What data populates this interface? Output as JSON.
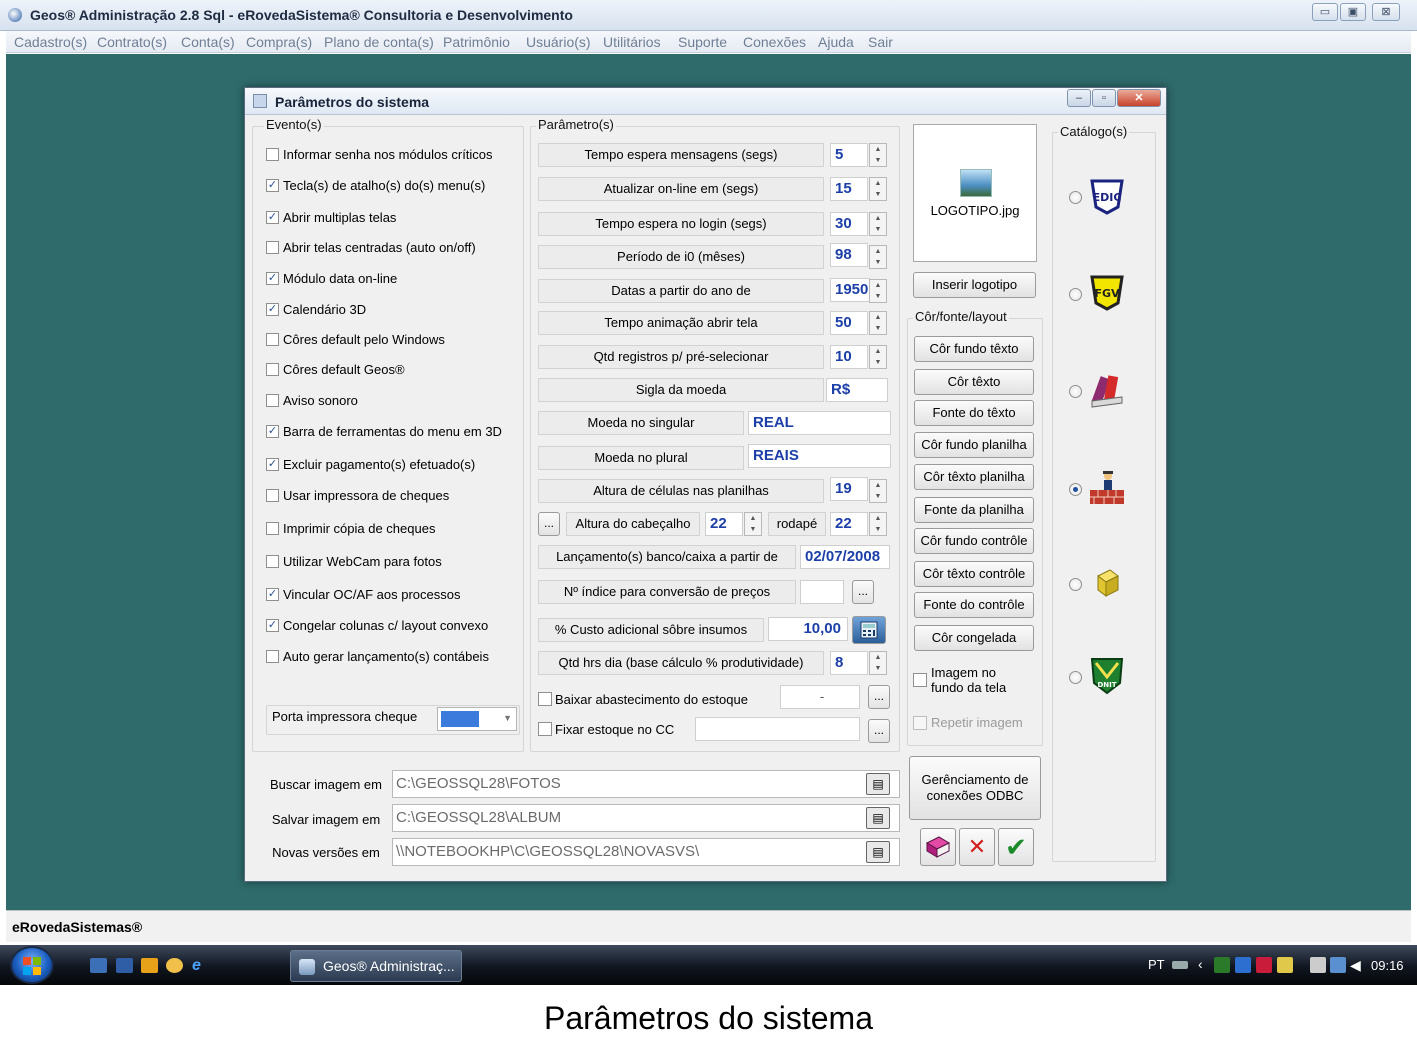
{
  "window": {
    "title": "Geos® Administração 2.8 Sql - eRovedaSistema® Consultoria e Desenvolvimento",
    "min": "▭",
    "max": "▣",
    "close": "⊠"
  },
  "menu": [
    "Cadastro(s)",
    "Contrato(s)",
    "Conta(s)",
    "Compra(s)",
    "Plano de conta(s)",
    "Patrimônio",
    "Usuário(s)",
    "Utilitários",
    "Suporte",
    "Conexões",
    "Ajuda",
    "Sair"
  ],
  "dialog": {
    "title": "Parâmetros do sistema",
    "min": "–",
    "max": "▫",
    "close": "✕"
  },
  "eventos": {
    "label": "Evento(s)",
    "items": [
      {
        "label": "Informar senha nos módulos críticos",
        "checked": false
      },
      {
        "label": "Tecla(s) de atalho(s) do(s) menu(s)",
        "checked": true
      },
      {
        "label": "Abrir multiplas telas",
        "checked": true
      },
      {
        "label": "Abrir telas centradas (auto on/off)",
        "checked": false
      },
      {
        "label": "Módulo data on-line",
        "checked": true
      },
      {
        "label": "Calendário 3D",
        "checked": true
      },
      {
        "label": "Côres default pelo Windows",
        "checked": false
      },
      {
        "label": "Côres default  Geos®",
        "checked": false
      },
      {
        "label": "Aviso sonoro",
        "checked": false
      },
      {
        "label": "Barra de ferramentas do menu em 3D",
        "checked": true
      },
      {
        "label": "Excluir pagamento(s) efetuado(s)",
        "checked": true
      },
      {
        "label": "Usar impressora de cheques",
        "checked": false
      },
      {
        "label": "Imprimir cópia de cheques",
        "checked": false
      },
      {
        "label": "Utilizar WebCam para fotos",
        "checked": false
      },
      {
        "label": "Vincular OC/AF aos processos",
        "checked": true
      },
      {
        "label": "Congelar colunas c/ layout convexo",
        "checked": true
      },
      {
        "label": "Auto gerar lançamento(s) contábeis",
        "checked": false
      }
    ],
    "porta_label": "Porta impressora cheque",
    "porta_value": ""
  },
  "parametros": {
    "label": "Parâmetro(s)",
    "tempo_mensagens": {
      "label": "Tempo espera mensagens (segs)",
      "value": "5"
    },
    "atualizar_online": {
      "label": "Atualizar  on-line em (segs)",
      "value": "15"
    },
    "tempo_login": {
      "label": "Tempo espera no login (segs)",
      "value": "30"
    },
    "periodo_i0": {
      "label": "Período de i0 (mêses)",
      "value": "98"
    },
    "datas_ano": {
      "label": "Datas a partir do ano de",
      "value": "1950"
    },
    "tempo_animacao": {
      "label": "Tempo animação abrir tela",
      "value": "50"
    },
    "qtd_registros": {
      "label": "Qtd registros p/ pré-selecionar",
      "value": "10"
    },
    "sigla_moeda": {
      "label": "Sigla da moeda",
      "value": "R$"
    },
    "moeda_singular": {
      "label": "Moeda no singular",
      "value": "REAL"
    },
    "moeda_plural": {
      "label": "Moeda no plural",
      "value": "REAIS"
    },
    "altura_celulas": {
      "label": "Altura de células nas planilhas",
      "value": "19"
    },
    "altura_cabecalho": {
      "label": "Altura do cabeçalho",
      "value": "22"
    },
    "rodape": {
      "label": "rodapé",
      "value": "22"
    },
    "lancamentos": {
      "label": "Lançamento(s) banco/caixa a partir de",
      "value": "02/07/2008"
    },
    "indice_precos": {
      "label": "Nº índice para conversão de preços",
      "value": ""
    },
    "custo_adicional": {
      "label": "% Custo adicional sôbre insumos",
      "value": "10,00"
    },
    "qtd_hrs": {
      "label": "Qtd hrs dia (base cálculo % produtividade)",
      "value": "8"
    },
    "baixar_estoque": {
      "label": "Baixar abastecimento do estoque",
      "value": "-",
      "checked": false
    },
    "fixar_estoque": {
      "label": "Fixar estoque no CC",
      "value": "",
      "checked": false
    },
    "dots": "..."
  },
  "logo": {
    "filename": "LOGOTIPO.jpg",
    "insert_label": "Inserir logotipo"
  },
  "cor": {
    "label": "Côr/fonte/layout",
    "buttons": [
      "Côr fundo têxto",
      "Côr têxto",
      "Fonte do têxto",
      "Côr fundo planilha",
      "Côr têxto planilha",
      "Fonte da planilha",
      "Côr fundo contrôle",
      "Côr têxto contrôle",
      "Fonte do contrôle",
      "Côr congelada"
    ],
    "imagem_fundo": "Imagem no fundo da tela",
    "repetir": "Repetir imagem"
  },
  "catalogo": {
    "label": "Catálogo(s)",
    "items": [
      "logo-ENDIC",
      "logo-FGV",
      "logo-books",
      "logo-worker-bricks",
      "logo-box",
      "logo-DNIT"
    ],
    "selected": 3
  },
  "paths": [
    {
      "label": "Buscar imagem em",
      "value": "C:\\GEOSSQL28\\FOTOS"
    },
    {
      "label": "Salvar imagem em",
      "value": "C:\\GEOSSQL28\\ALBUM"
    },
    {
      "label": "Novas versões em",
      "value": "\\\\NOTEBOOKHP\\C\\GEOSSQL28\\NOVASVS\\"
    }
  ],
  "odbc_label": "Gerênciamento de conexões ODBC",
  "toolbar": {
    "help": "book-icon",
    "cancel": "✕",
    "ok": "✔"
  },
  "status": "eRovedaSistemas®",
  "taskbar": {
    "task": "Geos® Administraç...",
    "lang": "PT",
    "clock": "09:16"
  },
  "caption": "Parâmetros do sistema",
  "colors": {
    "desktop": "#2f6b6b",
    "value_blue": "#1c3fa8"
  }
}
